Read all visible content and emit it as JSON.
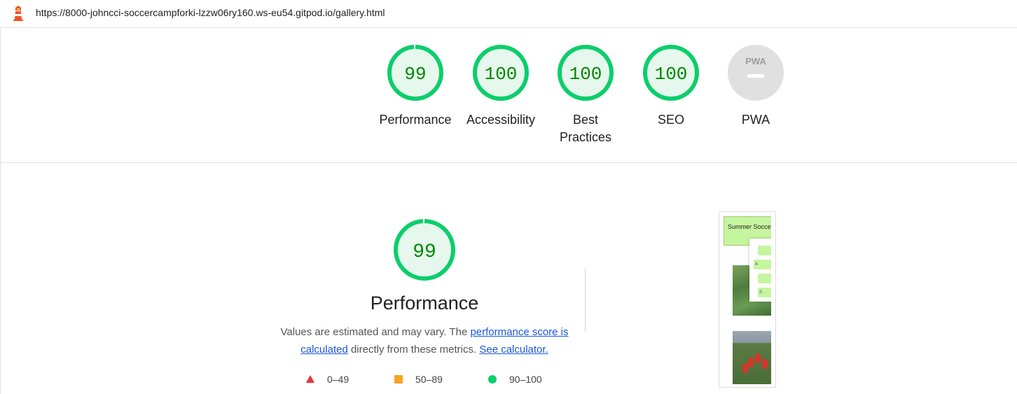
{
  "header": {
    "url": "https://8000-johncci-soccercampforki-lzzw06ry160.ws-eu54.gitpod.io/gallery.html"
  },
  "scores": [
    {
      "key": "performance",
      "value": "99",
      "label": "Performance",
      "score": 0.99
    },
    {
      "key": "accessibility",
      "value": "100",
      "label": "Accessibility",
      "score": 1.0
    },
    {
      "key": "best-practices",
      "value": "100",
      "label": "Best Practices",
      "score": 1.0
    },
    {
      "key": "seo",
      "value": "100",
      "label": "SEO",
      "score": 1.0
    },
    {
      "key": "pwa",
      "value": "PWA",
      "label": "PWA",
      "score": null
    }
  ],
  "performance": {
    "score": "99",
    "score_fraction": 0.99,
    "title": "Performance",
    "desc_prefix": "Values are estimated and may vary. The ",
    "desc_link1": "performance score is calculated",
    "desc_middle": " directly from these metrics. ",
    "desc_link2": "See calculator."
  },
  "legend": [
    {
      "range": "0–49",
      "shape": "triangle",
      "color": "#eb3434"
    },
    {
      "range": "50–89",
      "shape": "square",
      "color": "#f5a623"
    },
    {
      "range": "90–100",
      "shape": "circle",
      "color": "#0cce6b"
    }
  ],
  "thumbnail": {
    "header_text": "Summer Soccer Camp",
    "menu_letters": [
      "",
      "A",
      "",
      "S"
    ]
  },
  "colors": {
    "pass": "#0cce6b",
    "pass_fill": "#e6f8ee",
    "pass_text": "#008800",
    "pwa_gray": "#e0e0e0",
    "link": "#1a56db"
  }
}
